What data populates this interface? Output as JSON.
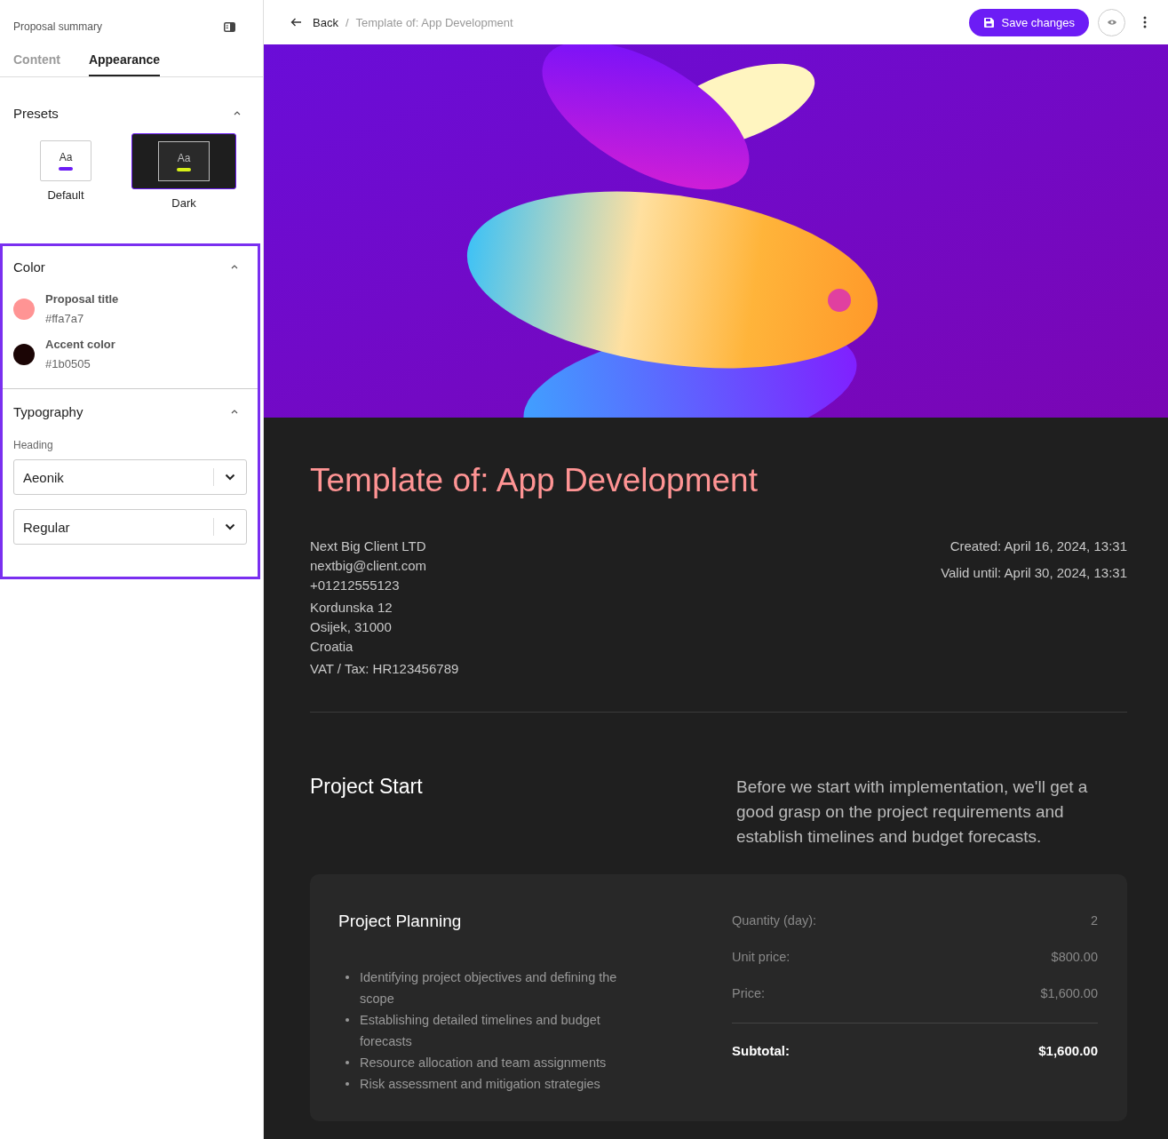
{
  "sidebar": {
    "title": "Proposal summary",
    "tabs": [
      {
        "label": "Content",
        "selected": false
      },
      {
        "label": "Appearance",
        "selected": true
      }
    ],
    "presets": {
      "title": "Presets",
      "expanded": true,
      "items": [
        {
          "label": "Default",
          "sample": "Aa",
          "kind": "light",
          "selected": false
        },
        {
          "label": "Dark",
          "sample": "Aa",
          "kind": "dark",
          "selected": true
        }
      ]
    },
    "color": {
      "title": "Color",
      "expanded": true,
      "items": [
        {
          "label": "Proposal title",
          "value": "#ffa7a7",
          "color": "#ff9494"
        },
        {
          "label": "Accent color",
          "value": "#1b0505",
          "color": "#1b0505"
        }
      ]
    },
    "typography": {
      "title": "Typography",
      "expanded": true,
      "label": "Heading",
      "selects": [
        {
          "value": "Aeonik"
        },
        {
          "value": "Regular"
        }
      ]
    }
  },
  "topbar": {
    "back": "Back",
    "separator": "/",
    "breadcrumb": "Template of: App Development",
    "save": "Save changes"
  },
  "document": {
    "title": "Template of: App Development",
    "client": [
      [
        "Next Big Client LTD",
        "nextbig@client.com",
        "+01212555123"
      ],
      [
        "Kordunska 12",
        "Osijek, 31000",
        "Croatia"
      ],
      [
        "VAT / Tax: HR123456789"
      ]
    ],
    "dates": [
      "Created: April 16, 2024, 13:31",
      "Valid until: April 30, 2024, 13:31"
    ],
    "section": {
      "title": "Project Start",
      "description": "Before we start with implementation, we'll get a good grasp on the project requirements and establish timelines and budget forecasts."
    },
    "item": {
      "title": "Project Planning",
      "bullets": [
        "Identifying project objectives and defining the scope",
        "Establishing detailed timelines and budget forecasts",
        "Resource allocation and team assignments",
        "Risk assessment and mitigation strategies"
      ],
      "rows": [
        {
          "label": "Quantity (day):",
          "value": "2"
        },
        {
          "label": "Unit price:",
          "value": "$800.00"
        },
        {
          "label": "Price:",
          "value": "$1,600.00"
        }
      ],
      "subtotal": {
        "label": "Subtotal:",
        "value": "$1,600.00"
      }
    }
  }
}
